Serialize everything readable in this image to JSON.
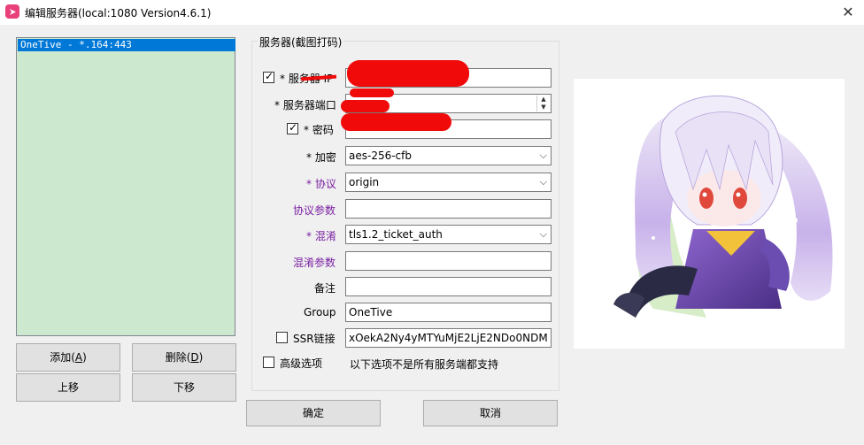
{
  "window": {
    "title": "编辑服务器(local:1080 Version4.6.1)",
    "close_glyph": "✕"
  },
  "server_list": {
    "items": [
      {
        "label": "OneTive - *.164:443"
      }
    ]
  },
  "list_buttons": {
    "add": {
      "label": "添加(",
      "mnemonic": "A",
      "suffix": ")"
    },
    "delete": {
      "label": "删除(",
      "mnemonic": "D",
      "suffix": ")"
    },
    "move_up": "上移",
    "move_down": "下移"
  },
  "group_box": {
    "title": "服务器(截图打码)"
  },
  "form": {
    "server_ip": {
      "label": "* 服务器 IP",
      "value": "",
      "checked": true
    },
    "server_port": {
      "label": "* 服务器端口",
      "value": ""
    },
    "password": {
      "label": "* 密码",
      "value": "",
      "checked": true
    },
    "encryption": {
      "label": "* 加密",
      "value": "aes-256-cfb"
    },
    "protocol": {
      "label": "* 协议",
      "value": "origin"
    },
    "protocol_param": {
      "label": "协议参数",
      "value": ""
    },
    "obfs": {
      "label": "* 混淆",
      "value": "tls1.2_ticket_auth"
    },
    "obfs_param": {
      "label": "混淆参数",
      "value": ""
    },
    "remarks": {
      "label": "备注",
      "value": ""
    },
    "group": {
      "label": "Group",
      "value": "OneTive"
    },
    "ssr_link": {
      "label": "SSR链接",
      "value": "xOekA2Ny4yMTYuMjE2LjE2NDo0NDM",
      "checked": false
    },
    "advanced": {
      "label": "高级选项",
      "note": "以下选项不是所有服务端都支持",
      "checked": false
    }
  },
  "footer": {
    "ok": "确定",
    "cancel": "取消"
  },
  "colors": {
    "list_bg": "#cce8cf",
    "selected_row": "#0078d7",
    "purple_label": "#7a1fa2",
    "redaction": "#f00a0a"
  },
  "icons": {
    "app": "shadowsocksr-icon",
    "close": "close-icon",
    "dropdown": "chevron-down-icon"
  }
}
